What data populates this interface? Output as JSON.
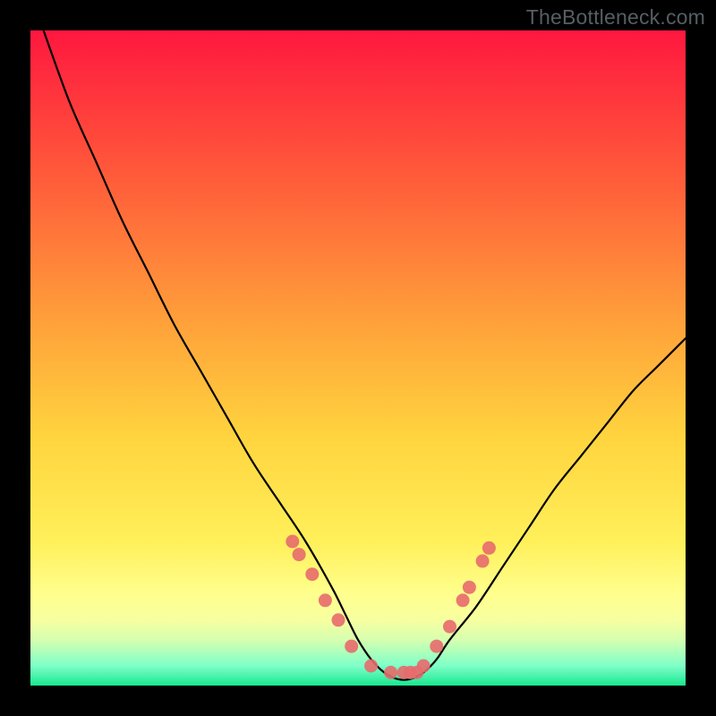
{
  "watermark": "TheBottleneck.com",
  "chart_data": {
    "type": "line",
    "title": "",
    "xlabel": "",
    "ylabel": "",
    "xlim": [
      0,
      100
    ],
    "ylim": [
      0,
      100
    ],
    "grid": false,
    "legend": false,
    "series": [
      {
        "name": "curve",
        "x": [
          2,
          6,
          10,
          14,
          18,
          22,
          26,
          30,
          34,
          38,
          42,
          46,
          48,
          50,
          52,
          54,
          56,
          58,
          60,
          62,
          64,
          68,
          72,
          76,
          80,
          84,
          88,
          92,
          96,
          100
        ],
        "y": [
          100,
          89,
          80,
          71,
          63,
          55,
          48,
          41,
          34,
          28,
          22,
          15,
          11,
          7,
          4,
          2,
          1,
          1,
          2,
          4,
          7,
          12,
          18,
          24,
          30,
          35,
          40,
          45,
          49,
          53
        ]
      }
    ],
    "markers": {
      "name": "dots",
      "x": [
        43,
        45,
        47,
        49,
        52,
        55,
        57,
        58,
        59,
        60,
        62,
        64,
        66,
        67,
        69,
        70,
        40,
        41
      ],
      "y": [
        17,
        13,
        10,
        6,
        3,
        2,
        2,
        2,
        2,
        3,
        6,
        9,
        13,
        15,
        19,
        21,
        22,
        20
      ]
    },
    "background_gradient": {
      "top": "#ff1744",
      "middle": "#ffd740",
      "lower": "#ffff8d",
      "bottom": "#00e676"
    },
    "line_color": "#000000",
    "marker_color": "#e86a6d"
  }
}
